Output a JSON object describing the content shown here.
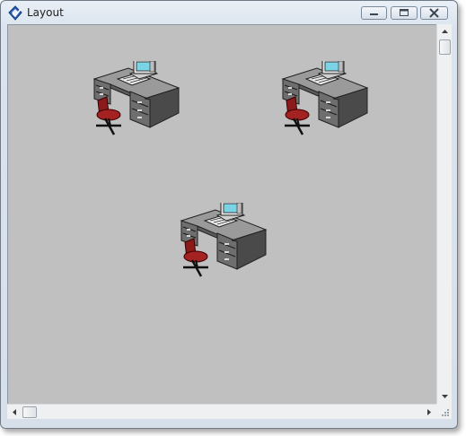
{
  "window": {
    "title": "Layout",
    "icon": "app-logo-icon",
    "controls": [
      "minimize-icon",
      "maximize-icon",
      "close-icon"
    ]
  },
  "canvas": {
    "background": "#c0c0c0",
    "items": [
      {
        "type": "workstation",
        "icon": "desk-computer-chair-icon"
      },
      {
        "type": "workstation",
        "icon": "desk-computer-chair-icon"
      },
      {
        "type": "workstation",
        "icon": "desk-computer-chair-icon"
      }
    ]
  },
  "colors": {
    "desk": "#707070",
    "chair": "#8b1a1a",
    "monitor_screen": "#7ad4e6"
  }
}
